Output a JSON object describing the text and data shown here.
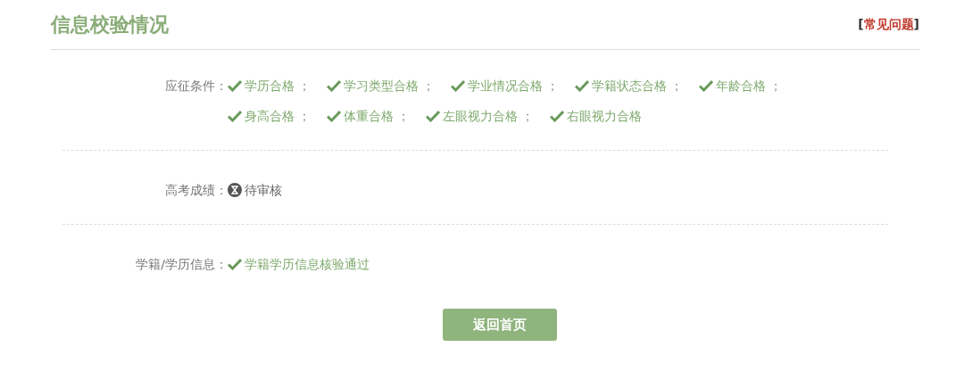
{
  "header": {
    "title": "信息校验情况",
    "faq_link": {
      "open": "[",
      "label": "常见问题",
      "close": "]"
    }
  },
  "rows": [
    {
      "label": "应征条件：",
      "items": [
        {
          "text": "学历合格",
          "kind": "passed",
          "separator": "；"
        },
        {
          "text": "学习类型合格",
          "kind": "passed",
          "separator": "；"
        },
        {
          "text": "学业情况合格",
          "kind": "passed",
          "separator": "；"
        },
        {
          "text": "学籍状态合格",
          "kind": "passed",
          "separator": "；"
        },
        {
          "text": "年龄合格",
          "kind": "passed",
          "separator": "；"
        },
        {
          "text": "身高合格",
          "kind": "passed",
          "separator": "；"
        },
        {
          "text": "体重合格",
          "kind": "passed",
          "separator": "；"
        },
        {
          "text": "左眼视力合格",
          "kind": "passed",
          "separator": "；"
        },
        {
          "text": "右眼视力合格",
          "kind": "passed"
        }
      ]
    },
    {
      "label": "高考成绩：",
      "items": [
        {
          "text": "待审核",
          "kind": "pending"
        }
      ]
    },
    {
      "label": "学籍/学历信息：",
      "items": [
        {
          "text": "学籍学历信息核验通过",
          "kind": "passed"
        }
      ]
    }
  ],
  "button": "返回首页"
}
